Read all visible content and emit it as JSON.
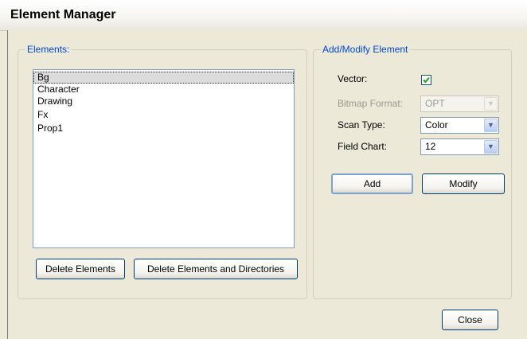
{
  "window": {
    "title": "Element Manager"
  },
  "elements_group": {
    "legend": "Elements:",
    "items": [
      "Bg",
      "Character",
      "Drawing",
      "Fx",
      "Prop1"
    ],
    "selected_index": 0,
    "delete_button": "Delete Elements",
    "delete_dirs_button": "Delete Elements and Directories"
  },
  "add_modify_group": {
    "legend": "Add/Modify Element",
    "vector_label": "Vector:",
    "vector_checked": true,
    "bitmap_format_label": "Bitmap Format:",
    "bitmap_format_value": "OPT",
    "scan_type_label": "Scan Type:",
    "scan_type_value": "Color",
    "field_chart_label": "Field Chart:",
    "field_chart_value": "12",
    "add_button": "Add",
    "modify_button": "Modify"
  },
  "footer": {
    "close_button": "Close"
  },
  "colors": {
    "legend": "#0046d5",
    "check": "#21a121"
  },
  "icons": {
    "combo_arrow": "chevron-down-icon",
    "checkmark": "checkmark-icon"
  }
}
